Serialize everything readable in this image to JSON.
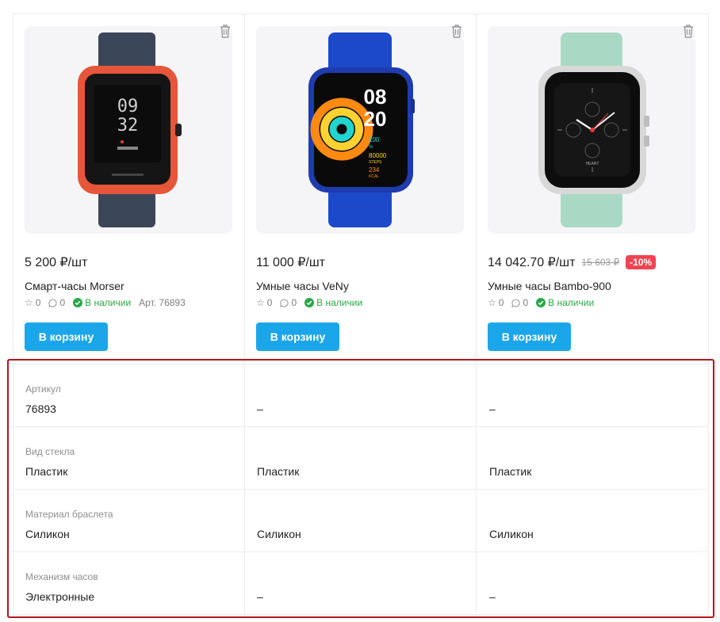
{
  "products": [
    {
      "price": "5 200 ₽/шт",
      "old_price": "",
      "discount": "",
      "name": "Смарт-часы Morser",
      "rating": "0",
      "reviews": "0",
      "stock": "В наличии",
      "article": "Арт. 76893",
      "button_label": "В корзину",
      "watch_screen": {
        "line1": "09",
        "line2": "32"
      },
      "colors": {
        "strap": "#3c4659",
        "case": "#e6563a"
      }
    },
    {
      "price": "11 000 ₽/шт",
      "old_price": "",
      "discount": "",
      "name": "Умные часы VeNy",
      "rating": "0",
      "reviews": "0",
      "stock": "В наличии",
      "article": "",
      "button_label": "В корзину",
      "watch_screen": {
        "line1": "08",
        "line2": "20",
        "stat1": "100",
        "stat1_unit": "%",
        "stat2": "80000",
        "stat2_unit": "STEPS",
        "stat3": "234",
        "stat3_unit": "KCAL"
      },
      "colors": {
        "strap": "#1b49c9",
        "case": "#1f3cae"
      }
    },
    {
      "price": "14 042.70 ₽/шт",
      "old_price": "15 603 ₽",
      "discount": "-10%",
      "name": "Умные часы Bambo-900",
      "rating": "0",
      "reviews": "0",
      "stock": "В наличии",
      "article": "",
      "button_label": "В корзину",
      "watch_screen": {
        "dial_text": "HEART"
      },
      "colors": {
        "strap": "#a9d9c4",
        "case": "#d8d8d8"
      }
    }
  ],
  "specs": [
    {
      "label": "Артикул",
      "values": [
        "76893",
        "–",
        "–"
      ]
    },
    {
      "label": "Вид стекла",
      "values": [
        "Пластик",
        "Пластик",
        "Пластик"
      ]
    },
    {
      "label": "Материал браслета",
      "values": [
        "Силикон",
        "Силикон",
        "Силикон"
      ]
    },
    {
      "label": "Механизм часов",
      "values": [
        "Электронные",
        "–",
        "–"
      ]
    }
  ],
  "theme": {
    "accent": "#1ca6ea",
    "stock_green": "#2aa84a",
    "discount_red": "#f04453",
    "highlight_red": "#b5161c"
  }
}
